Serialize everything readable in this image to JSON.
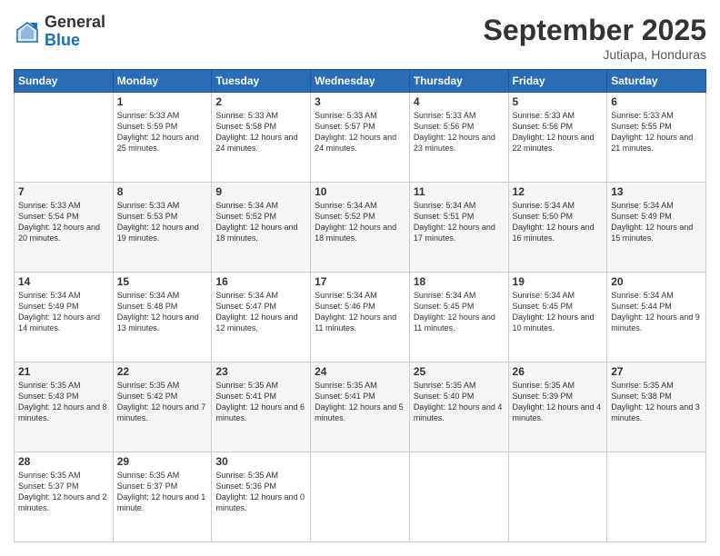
{
  "logo": {
    "general": "General",
    "blue": "Blue"
  },
  "header": {
    "month": "September 2025",
    "location": "Jutiapa, Honduras"
  },
  "days": [
    "Sunday",
    "Monday",
    "Tuesday",
    "Wednesday",
    "Thursday",
    "Friday",
    "Saturday"
  ],
  "weeks": [
    [
      {
        "day": "",
        "sunrise": "",
        "sunset": "",
        "daylight": ""
      },
      {
        "day": "1",
        "sunrise": "Sunrise: 5:33 AM",
        "sunset": "Sunset: 5:59 PM",
        "daylight": "Daylight: 12 hours and 25 minutes."
      },
      {
        "day": "2",
        "sunrise": "Sunrise: 5:33 AM",
        "sunset": "Sunset: 5:58 PM",
        "daylight": "Daylight: 12 hours and 24 minutes."
      },
      {
        "day": "3",
        "sunrise": "Sunrise: 5:33 AM",
        "sunset": "Sunset: 5:57 PM",
        "daylight": "Daylight: 12 hours and 24 minutes."
      },
      {
        "day": "4",
        "sunrise": "Sunrise: 5:33 AM",
        "sunset": "Sunset: 5:56 PM",
        "daylight": "Daylight: 12 hours and 23 minutes."
      },
      {
        "day": "5",
        "sunrise": "Sunrise: 5:33 AM",
        "sunset": "Sunset: 5:56 PM",
        "daylight": "Daylight: 12 hours and 22 minutes."
      },
      {
        "day": "6",
        "sunrise": "Sunrise: 5:33 AM",
        "sunset": "Sunset: 5:55 PM",
        "daylight": "Daylight: 12 hours and 21 minutes."
      }
    ],
    [
      {
        "day": "7",
        "sunrise": "Sunrise: 5:33 AM",
        "sunset": "Sunset: 5:54 PM",
        "daylight": "Daylight: 12 hours and 20 minutes."
      },
      {
        "day": "8",
        "sunrise": "Sunrise: 5:33 AM",
        "sunset": "Sunset: 5:53 PM",
        "daylight": "Daylight: 12 hours and 19 minutes."
      },
      {
        "day": "9",
        "sunrise": "Sunrise: 5:34 AM",
        "sunset": "Sunset: 5:52 PM",
        "daylight": "Daylight: 12 hours and 18 minutes."
      },
      {
        "day": "10",
        "sunrise": "Sunrise: 5:34 AM",
        "sunset": "Sunset: 5:52 PM",
        "daylight": "Daylight: 12 hours and 18 minutes."
      },
      {
        "day": "11",
        "sunrise": "Sunrise: 5:34 AM",
        "sunset": "Sunset: 5:51 PM",
        "daylight": "Daylight: 12 hours and 17 minutes."
      },
      {
        "day": "12",
        "sunrise": "Sunrise: 5:34 AM",
        "sunset": "Sunset: 5:50 PM",
        "daylight": "Daylight: 12 hours and 16 minutes."
      },
      {
        "day": "13",
        "sunrise": "Sunrise: 5:34 AM",
        "sunset": "Sunset: 5:49 PM",
        "daylight": "Daylight: 12 hours and 15 minutes."
      }
    ],
    [
      {
        "day": "14",
        "sunrise": "Sunrise: 5:34 AM",
        "sunset": "Sunset: 5:49 PM",
        "daylight": "Daylight: 12 hours and 14 minutes."
      },
      {
        "day": "15",
        "sunrise": "Sunrise: 5:34 AM",
        "sunset": "Sunset: 5:48 PM",
        "daylight": "Daylight: 12 hours and 13 minutes."
      },
      {
        "day": "16",
        "sunrise": "Sunrise: 5:34 AM",
        "sunset": "Sunset: 5:47 PM",
        "daylight": "Daylight: 12 hours and 12 minutes."
      },
      {
        "day": "17",
        "sunrise": "Sunrise: 5:34 AM",
        "sunset": "Sunset: 5:46 PM",
        "daylight": "Daylight: 12 hours and 11 minutes."
      },
      {
        "day": "18",
        "sunrise": "Sunrise: 5:34 AM",
        "sunset": "Sunset: 5:45 PM",
        "daylight": "Daylight: 12 hours and 11 minutes."
      },
      {
        "day": "19",
        "sunrise": "Sunrise: 5:34 AM",
        "sunset": "Sunset: 5:45 PM",
        "daylight": "Daylight: 12 hours and 10 minutes."
      },
      {
        "day": "20",
        "sunrise": "Sunrise: 5:34 AM",
        "sunset": "Sunset: 5:44 PM",
        "daylight": "Daylight: 12 hours and 9 minutes."
      }
    ],
    [
      {
        "day": "21",
        "sunrise": "Sunrise: 5:35 AM",
        "sunset": "Sunset: 5:43 PM",
        "daylight": "Daylight: 12 hours and 8 minutes."
      },
      {
        "day": "22",
        "sunrise": "Sunrise: 5:35 AM",
        "sunset": "Sunset: 5:42 PM",
        "daylight": "Daylight: 12 hours and 7 minutes."
      },
      {
        "day": "23",
        "sunrise": "Sunrise: 5:35 AM",
        "sunset": "Sunset: 5:41 PM",
        "daylight": "Daylight: 12 hours and 6 minutes."
      },
      {
        "day": "24",
        "sunrise": "Sunrise: 5:35 AM",
        "sunset": "Sunset: 5:41 PM",
        "daylight": "Daylight: 12 hours and 5 minutes."
      },
      {
        "day": "25",
        "sunrise": "Sunrise: 5:35 AM",
        "sunset": "Sunset: 5:40 PM",
        "daylight": "Daylight: 12 hours and 4 minutes."
      },
      {
        "day": "26",
        "sunrise": "Sunrise: 5:35 AM",
        "sunset": "Sunset: 5:39 PM",
        "daylight": "Daylight: 12 hours and 4 minutes."
      },
      {
        "day": "27",
        "sunrise": "Sunrise: 5:35 AM",
        "sunset": "Sunset: 5:38 PM",
        "daylight": "Daylight: 12 hours and 3 minutes."
      }
    ],
    [
      {
        "day": "28",
        "sunrise": "Sunrise: 5:35 AM",
        "sunset": "Sunset: 5:37 PM",
        "daylight": "Daylight: 12 hours and 2 minutes."
      },
      {
        "day": "29",
        "sunrise": "Sunrise: 5:35 AM",
        "sunset": "Sunset: 5:37 PM",
        "daylight": "Daylight: 12 hours and 1 minute."
      },
      {
        "day": "30",
        "sunrise": "Sunrise: 5:35 AM",
        "sunset": "Sunset: 5:36 PM",
        "daylight": "Daylight: 12 hours and 0 minutes."
      },
      {
        "day": "",
        "sunrise": "",
        "sunset": "",
        "daylight": ""
      },
      {
        "day": "",
        "sunrise": "",
        "sunset": "",
        "daylight": ""
      },
      {
        "day": "",
        "sunrise": "",
        "sunset": "",
        "daylight": ""
      },
      {
        "day": "",
        "sunrise": "",
        "sunset": "",
        "daylight": ""
      }
    ]
  ]
}
